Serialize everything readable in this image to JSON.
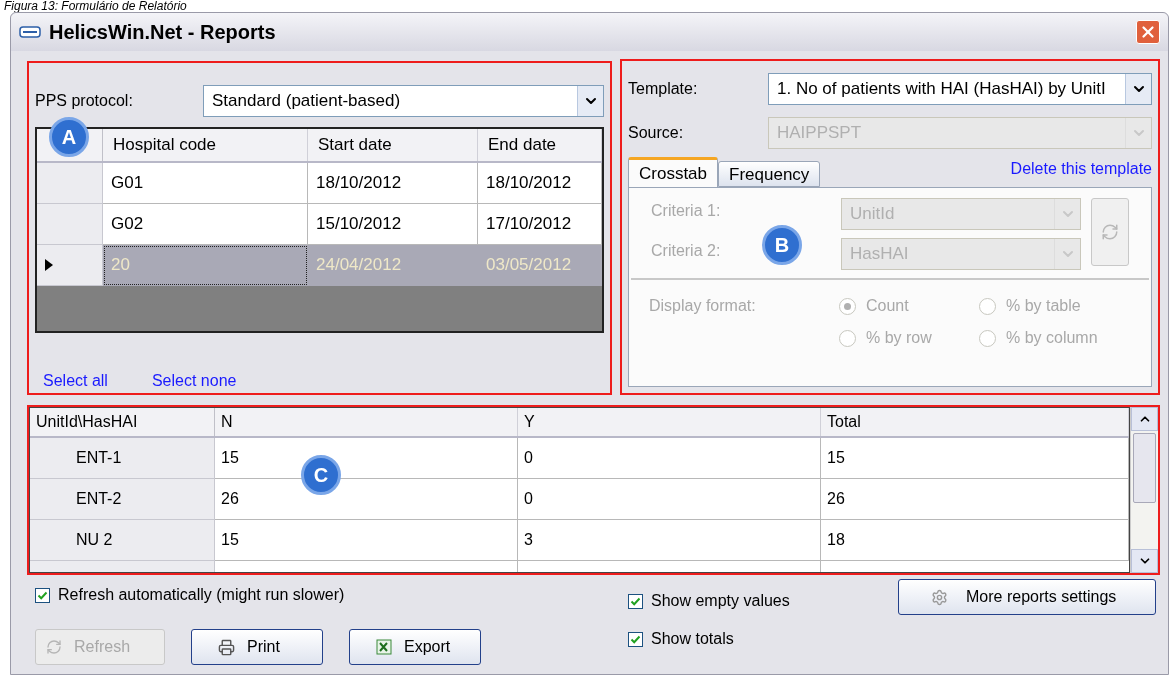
{
  "caption": "Figura 13: Formulário de Relatório",
  "window": {
    "title": "HelicsWin.Net - Reports"
  },
  "selection_panel": {
    "protocol_label": "PPS protocol:",
    "protocol_value": "Standard (patient-based)",
    "columns": [
      "Hospital code",
      "Start date",
      "End date"
    ],
    "rows": [
      {
        "cells": [
          "G01",
          "18/10/2012",
          "18/10/2012"
        ],
        "selected": false
      },
      {
        "cells": [
          "G02",
          "15/10/2012",
          "17/10/2012"
        ],
        "selected": false
      },
      {
        "cells": [
          "20",
          "24/04/2012",
          "03/05/2012"
        ],
        "selected": true
      }
    ],
    "links": [
      "Select all",
      "Select none"
    ]
  },
  "template_panel": {
    "template_label": "Template:",
    "template_value": "1. No of patients with HAI (HasHAI) by UnitI",
    "source_label": "Source:",
    "source_value": "HAIPPSPT",
    "tabs": [
      {
        "label": "Crosstab",
        "selected": true
      },
      {
        "label": "Frequency",
        "selected": false
      }
    ],
    "delete_link": "Delete this template",
    "disabled": true,
    "criteria": [
      {
        "label": "Criteria 1:",
        "value": "UnitId"
      },
      {
        "label": "Criteria 2:",
        "value": "HasHAI"
      }
    ],
    "display_format_label": "Display format:",
    "formats": [
      {
        "label": "Count",
        "selected": true
      },
      {
        "label": "% by table",
        "selected": false
      },
      {
        "label": "% by row",
        "selected": false
      },
      {
        "label": "% by column",
        "selected": false
      }
    ]
  },
  "results": {
    "corner": "UnitId\\HasHAI",
    "columns": [
      "N",
      "Y",
      "Total"
    ],
    "rows": [
      {
        "label": "ENT-1",
        "cells": [
          "15",
          "0",
          "15"
        ]
      },
      {
        "label": "ENT-2",
        "cells": [
          "26",
          "0",
          "26"
        ]
      },
      {
        "label": "NU 2",
        "cells": [
          "15",
          "3",
          "18"
        ]
      }
    ]
  },
  "refresh_option": {
    "label": "Refresh automatically (might run slower)",
    "checked": true
  },
  "display_options": [
    {
      "label": "Show empty values",
      "checked": true
    },
    {
      "label": "Show totals",
      "checked": true
    }
  ],
  "buttons": [
    {
      "kind": "refresh",
      "label": "Refresh",
      "disabled": true
    },
    {
      "kind": "print",
      "label": "Print",
      "disabled": false
    },
    {
      "kind": "export",
      "label": "Export",
      "disabled": false
    }
  ],
  "settings_button": "More reports settings",
  "callouts": [
    "A",
    "B",
    "C"
  ]
}
